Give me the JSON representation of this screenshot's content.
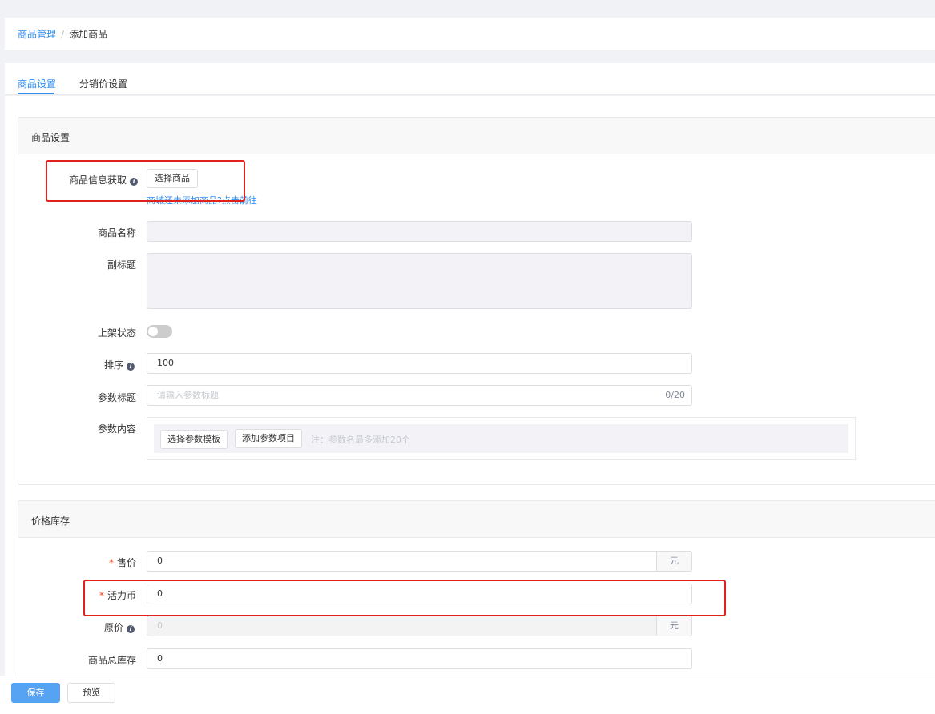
{
  "breadcrumb": {
    "parent": "商品管理",
    "separator": "/",
    "current": "添加商品"
  },
  "tabs": [
    {
      "label": "商品设置",
      "active": true
    },
    {
      "label": "分销价设置",
      "active": false
    }
  ],
  "product_section": {
    "title": "商品设置",
    "fetch_info": {
      "label": "商品信息获取",
      "button": "选择商品",
      "link_text": "商城还未添加商品?点击前往"
    },
    "name": {
      "label": "商品名称",
      "value": ""
    },
    "subtitle": {
      "label": "副标题",
      "value": ""
    },
    "listing_status": {
      "label": "上架状态",
      "on": false
    },
    "sort": {
      "label": "排序",
      "value": "100"
    },
    "param_title": {
      "label": "参数标题",
      "placeholder": "请输入参数标题",
      "counter": "0/20"
    },
    "param_content": {
      "label": "参数内容",
      "template_button": "选择参数模板",
      "add_button": "添加参数项目",
      "note": "注：参数名最多添加20个"
    }
  },
  "price_section": {
    "title": "价格库存",
    "sale_price": {
      "label": "售价",
      "value": "0",
      "unit": "元",
      "required": "*"
    },
    "coins": {
      "label": "活力币",
      "value": "0",
      "required": "*"
    },
    "original_price": {
      "label": "原价",
      "value": "0",
      "unit": "元"
    },
    "stock": {
      "label": "商品总库存",
      "value": "0"
    }
  },
  "footer": {
    "save": "保存",
    "preview": "预览"
  },
  "colors": {
    "primary": "#2d8cf0",
    "save_button": "#57a3f3",
    "required": "#ed4014",
    "highlight": "#e0211c"
  }
}
